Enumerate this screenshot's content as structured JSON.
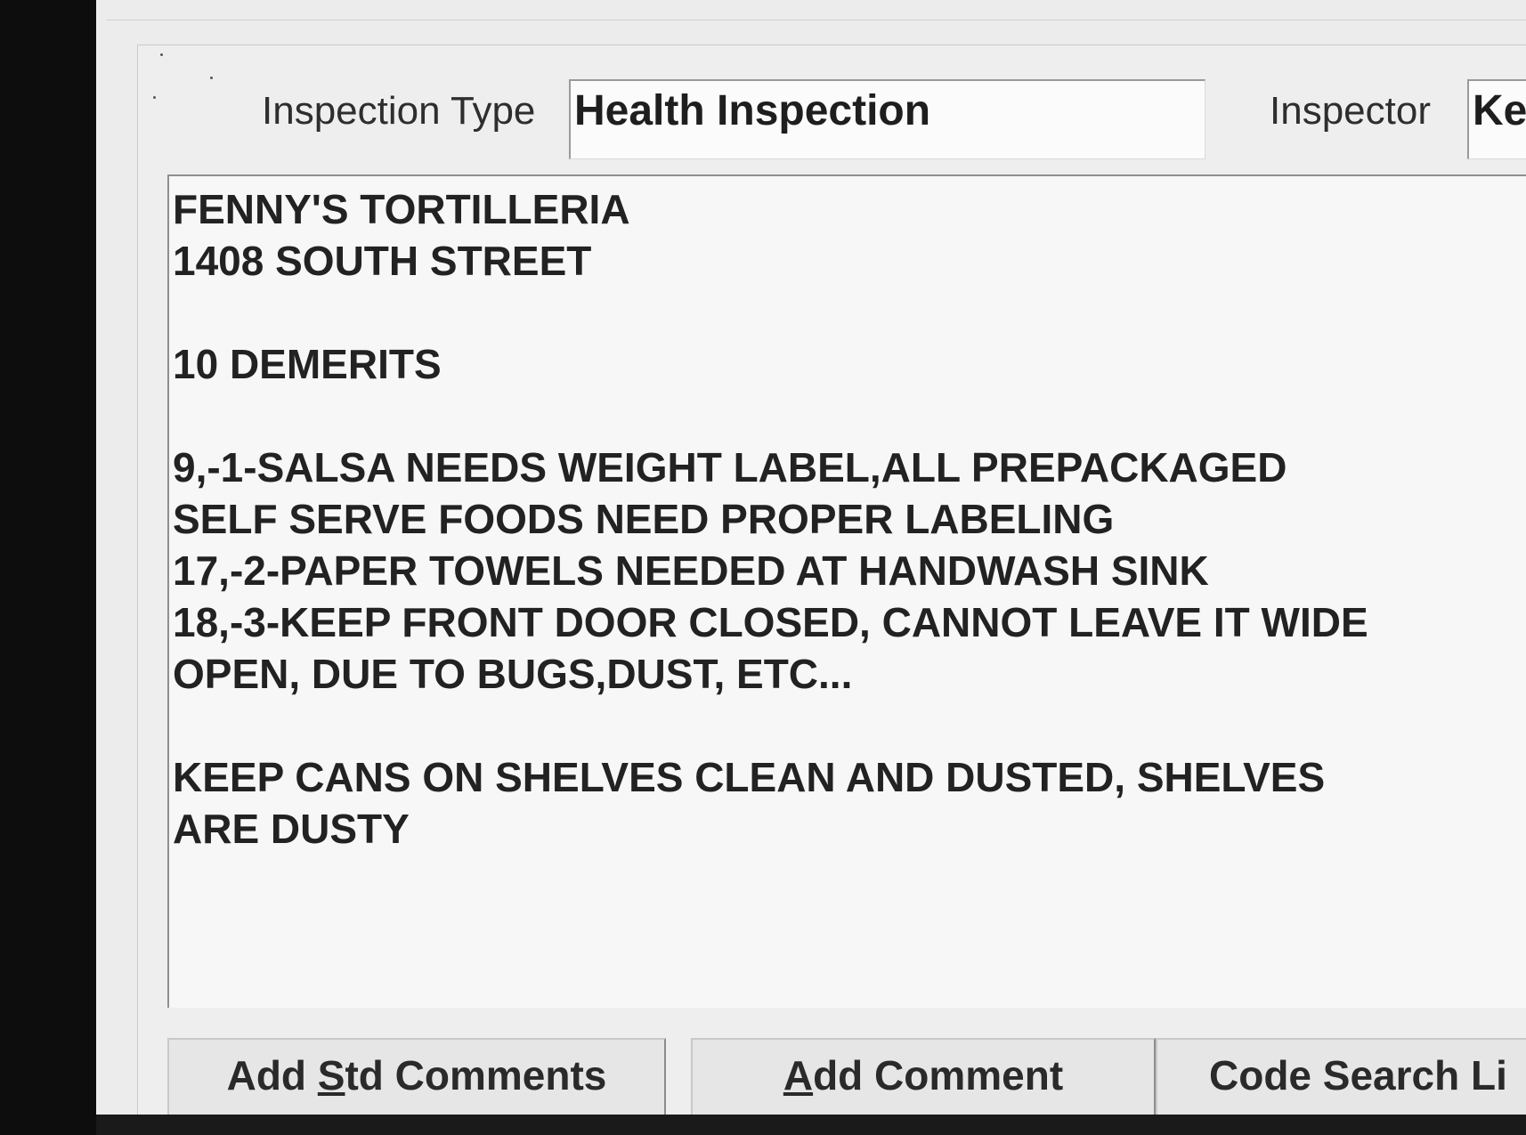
{
  "fields": {
    "inspection_type_label": "Inspection Type",
    "inspection_type_value": "Health Inspection",
    "inspector_label": "Inspector",
    "inspector_value": "Ke"
  },
  "comments": {
    "lines": [
      "FENNY'S TORTILLERIA",
      "1408 SOUTH STREET",
      "",
      "10 DEMERITS",
      "",
      "9,-1-SALSA NEEDS WEIGHT LABEL,ALL PREPACKAGED",
      "SELF SERVE FOODS NEED PROPER LABELING",
      "17,-2-PAPER TOWELS NEEDED AT HANDWASH SINK",
      "18,-3-KEEP FRONT DOOR CLOSED, CANNOT LEAVE IT WIDE",
      "OPEN, DUE TO BUGS,DUST, ETC...",
      "",
      "KEEP CANS ON SHELVES CLEAN AND DUSTED, SHELVES",
      "ARE DUSTY"
    ]
  },
  "buttons": {
    "add_std_comments": {
      "before": "Add ",
      "mnemonic": "S",
      "after": "td Comments"
    },
    "add_comment": {
      "before": "",
      "mnemonic": "A",
      "after": "dd Comment"
    },
    "code_search": {
      "label": "Code Search Li"
    }
  }
}
